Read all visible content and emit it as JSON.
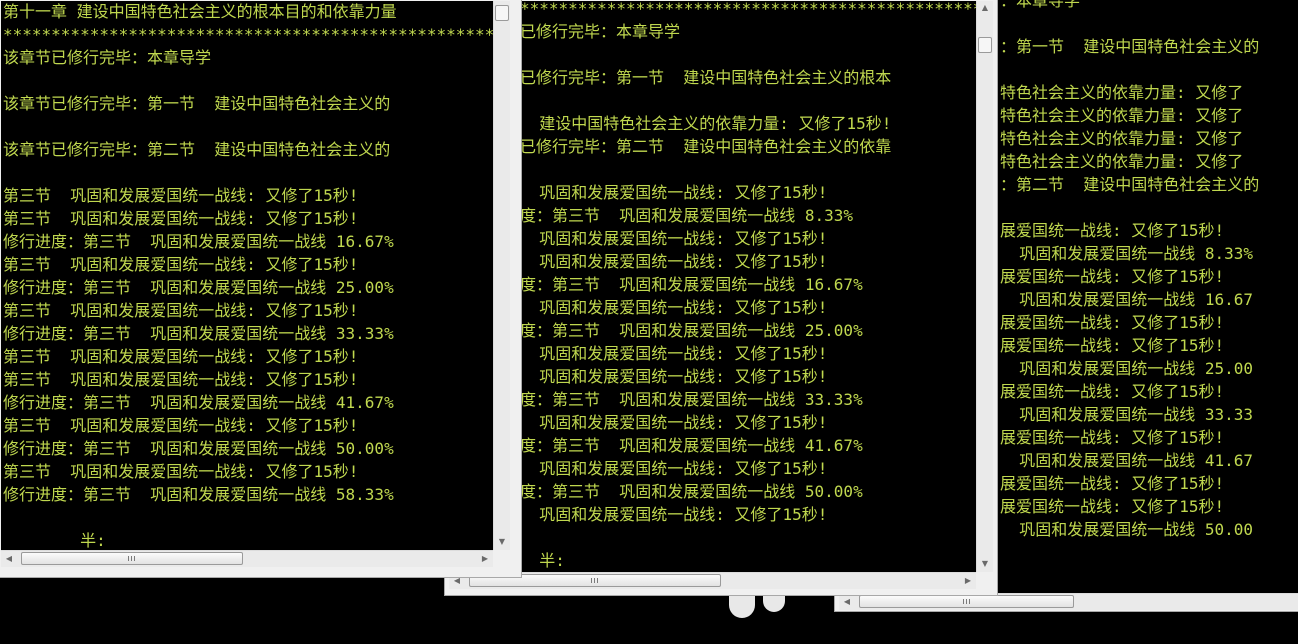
{
  "windows": [
    {
      "id": "console-1",
      "lines": [
        "第十一章 建设中国特色社会主义的根本目的和依靠力量",
        "**********************************************************",
        "该章节已修行完毕：本章导学",
        "",
        "该章节已修行完毕：第一节  建设中国特色社会主义的",
        "",
        "该章节已修行完毕：第二节  建设中国特色社会主义的",
        "",
        "第三节  巩固和发展爱国统一战线: 又修了15秒!",
        "第三节  巩固和发展爱国统一战线: 又修了15秒!",
        "修行进度：第三节  巩固和发展爱国统一战线 16.67%",
        "第三节  巩固和发展爱国统一战线: 又修了15秒!",
        "修行进度：第三节  巩固和发展爱国统一战线 25.00%",
        "第三节  巩固和发展爱国统一战线: 又修了15秒!",
        "修行进度：第三节  巩固和发展爱国统一战线 33.33%",
        "第三节  巩固和发展爱国统一战线: 又修了15秒!",
        "第三节  巩固和发展爱国统一战线: 又修了15秒!",
        "修行进度：第三节  巩固和发展爱国统一战线 41.67%",
        "第三节  巩固和发展爱国统一战线: 又修了15秒!",
        "修行进度：第三节  巩固和发展爱国统一战线 50.00%",
        "第三节  巩固和发展爱国统一战线: 又修了15秒!",
        "修行进度：第三节  巩固和发展爱国统一战线 58.33%",
        "",
        "        半:"
      ]
    },
    {
      "id": "console-2",
      "lines": [
        "***************************************************",
        "已修行完毕：本章导学",
        "",
        "已修行完毕：第一节  建设中国特色社会主义的根本",
        "",
        "  建设中国特色社会主义的依靠力量: 又修了15秒!",
        "已修行完毕：第二节  建设中国特色社会主义的依靠",
        "",
        "  巩固和发展爱国统一战线: 又修了15秒!",
        "度：第三节  巩固和发展爱国统一战线 8.33%",
        "  巩固和发展爱国统一战线: 又修了15秒!",
        "  巩固和发展爱国统一战线: 又修了15秒!",
        "度：第三节  巩固和发展爱国统一战线 16.67%",
        "  巩固和发展爱国统一战线: 又修了15秒!",
        "度：第三节  巩固和发展爱国统一战线 25.00%",
        "  巩固和发展爱国统一战线: 又修了15秒!",
        "  巩固和发展爱国统一战线: 又修了15秒!",
        "度：第三节  巩固和发展爱国统一战线 33.33%",
        "  巩固和发展爱国统一战线: 又修了15秒!",
        "度：第三节  巩固和发展爱国统一战线 41.67%",
        "  巩固和发展爱国统一战线: 又修了15秒!",
        "度：第三节  巩固和发展爱国统一战线 50.00%",
        "  巩固和发展爱国统一战线: 又修了15秒!",
        "",
        "  半:"
      ]
    },
    {
      "id": "console-3",
      "lines": [
        "：本章导学",
        "",
        "：第一节  建设中国特色社会主义的",
        "",
        "特色社会主义的依靠力量: 又修了",
        "特色社会主义的依靠力量: 又修了",
        "特色社会主义的依靠力量: 又修了",
        "特色社会主义的依靠力量: 又修了",
        "：第二节  建设中国特色社会主义的",
        "",
        "展爱国统一战线: 又修了15秒!",
        "  巩固和发展爱国统一战线 8.33%",
        "展爱国统一战线: 又修了15秒!",
        "  巩固和发展爱国统一战线 16.67",
        "展爱国统一战线: 又修了15秒!",
        "展爱国统一战线: 又修了15秒!",
        "  巩固和发展爱国统一战线 25.00",
        "展爱国统一战线: 又修了15秒!",
        "  巩固和发展爱国统一战线 33.33",
        "展爱国统一战线: 又修了15秒!",
        "  巩固和发展爱国统一战线 41.67",
        "展爱国统一战线: 又修了15秒!",
        "展爱国统一战线: 又修了15秒!",
        "  巩固和发展爱国统一战线 50.00"
      ]
    }
  ],
  "scroll_icons": {
    "up": "▲",
    "down": "▼",
    "left": "◀",
    "right": "▶"
  },
  "colors": {
    "console_background": "#000000",
    "console_text": "#c0d84f",
    "window_frame": "#f0f0f0"
  }
}
